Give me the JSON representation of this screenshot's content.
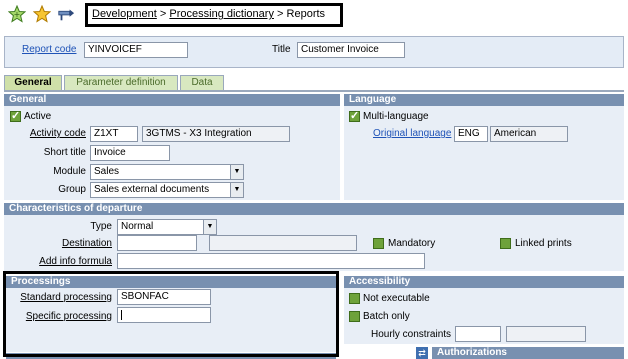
{
  "toolbar": {
    "icons": [
      "star-add-icon",
      "star-icon",
      "pin-icon"
    ],
    "breadcrumb": {
      "items": [
        "Development",
        "Processing dictionary",
        "Reports"
      ],
      "separator": ">"
    }
  },
  "header": {
    "report_code_label": "Report code",
    "report_code_value": "YINVOICEF",
    "title_label": "Title",
    "title_value": "Customer Invoice"
  },
  "tabs": [
    {
      "label": "General",
      "active": true
    },
    {
      "label": "Parameter definition",
      "active": false
    },
    {
      "label": "Data",
      "active": false
    }
  ],
  "general": {
    "heading": "General",
    "active_label": "Active",
    "activity_code_label": "Activity code",
    "activity_code_value": "Z1XT",
    "activity_code_desc": "3GTMS - X3 Integration",
    "short_title_label": "Short title",
    "short_title_value": "Invoice",
    "module_label": "Module",
    "module_value": "Sales",
    "group_label": "Group",
    "group_value": "Sales external documents"
  },
  "language": {
    "heading": "Language",
    "multi_language_label": "Multi-language",
    "original_language_label": "Original language",
    "original_language_code": "ENG",
    "original_language_name": "American"
  },
  "departure": {
    "heading": "Characteristics of departure",
    "type_label": "Type",
    "type_value": "Normal",
    "destination_label": "Destination",
    "mandatory_label": "Mandatory",
    "linked_prints_label": "Linked prints",
    "add_info_label": "Add info formula"
  },
  "processings": {
    "heading": "Processings",
    "standard_label": "Standard processing",
    "standard_value": "SBONFAC",
    "specific_label": "Specific processing",
    "specific_value": ""
  },
  "accessibility": {
    "heading": "Accessibility",
    "not_executable_label": "Not executable",
    "batch_only_label": "Batch only",
    "hourly_label": "Hourly constraints"
  },
  "bottom": {
    "authorizations_label": "Authorizations"
  },
  "colors": {
    "section_header": "#7890b0",
    "panel_bg": "#e4ecf6",
    "checkbox": "#6ea23a",
    "link": "#1f53b7"
  }
}
